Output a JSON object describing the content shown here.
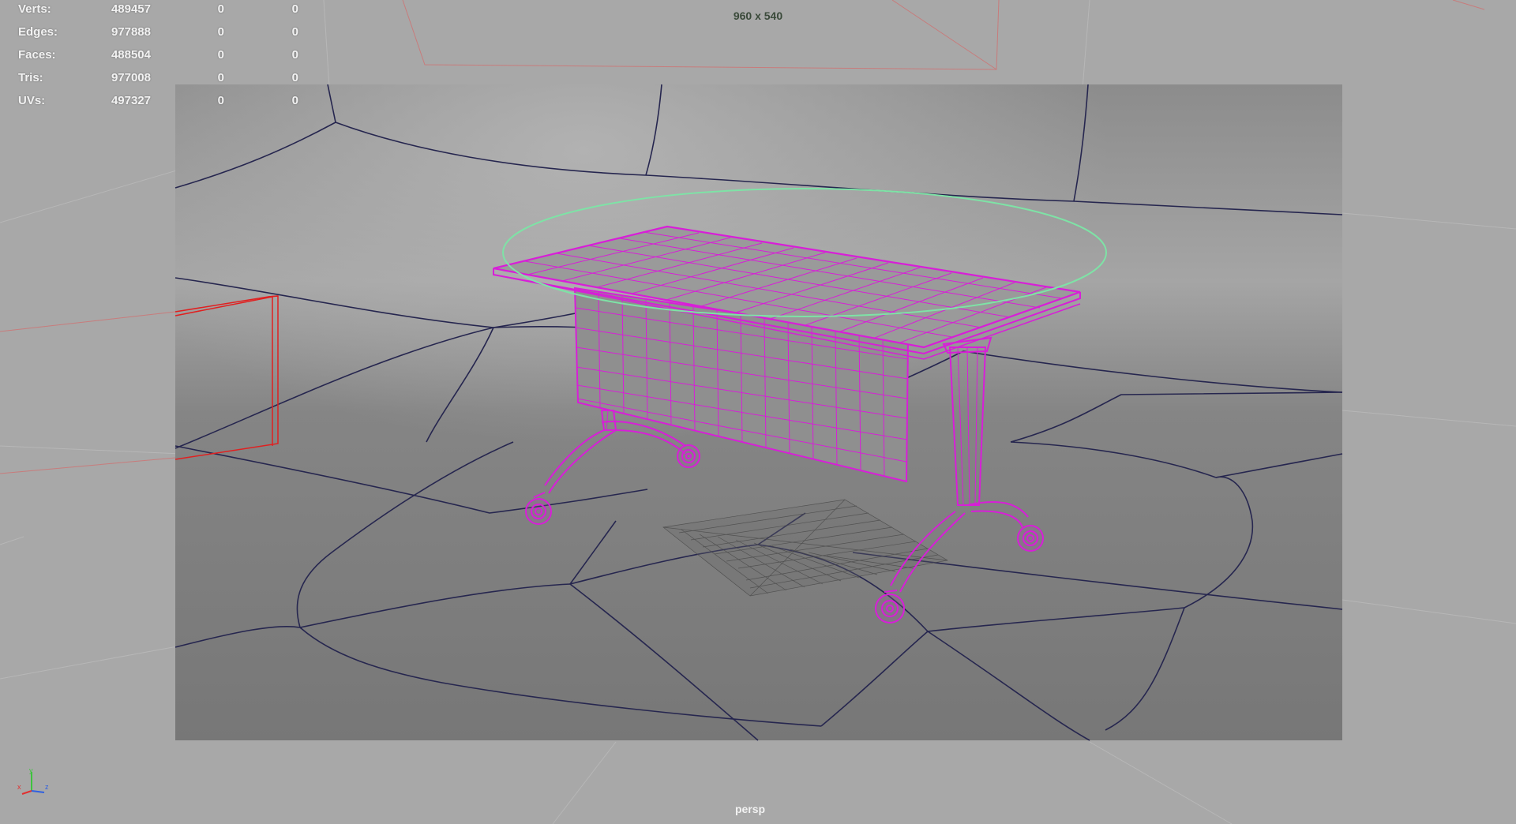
{
  "stats": [
    {
      "label": "Verts:",
      "total": "489457",
      "selected": "0",
      "components": "0"
    },
    {
      "label": "Edges:",
      "total": "977888",
      "selected": "0",
      "components": "0"
    },
    {
      "label": "Faces:",
      "total": "488504",
      "selected": "0",
      "components": "0"
    },
    {
      "label": "Tris:",
      "total": "977008",
      "selected": "0",
      "components": "0"
    },
    {
      "label": "UVs:",
      "total": "497327",
      "selected": "0",
      "components": "0"
    }
  ],
  "viewport": {
    "resolution_gate": "960 x 540",
    "camera_name": "persp"
  },
  "axis_indicator": {
    "x": "x",
    "y": "y",
    "z": "z"
  },
  "colors": {
    "viewport_bg": "#a8a8a8",
    "gate_bg": "#7d7d7d",
    "wire_mesh": "#d81ed8",
    "wire_floor": "#26264f",
    "selection_circle": "#7ee3a6",
    "light_locator": "#e02020"
  }
}
